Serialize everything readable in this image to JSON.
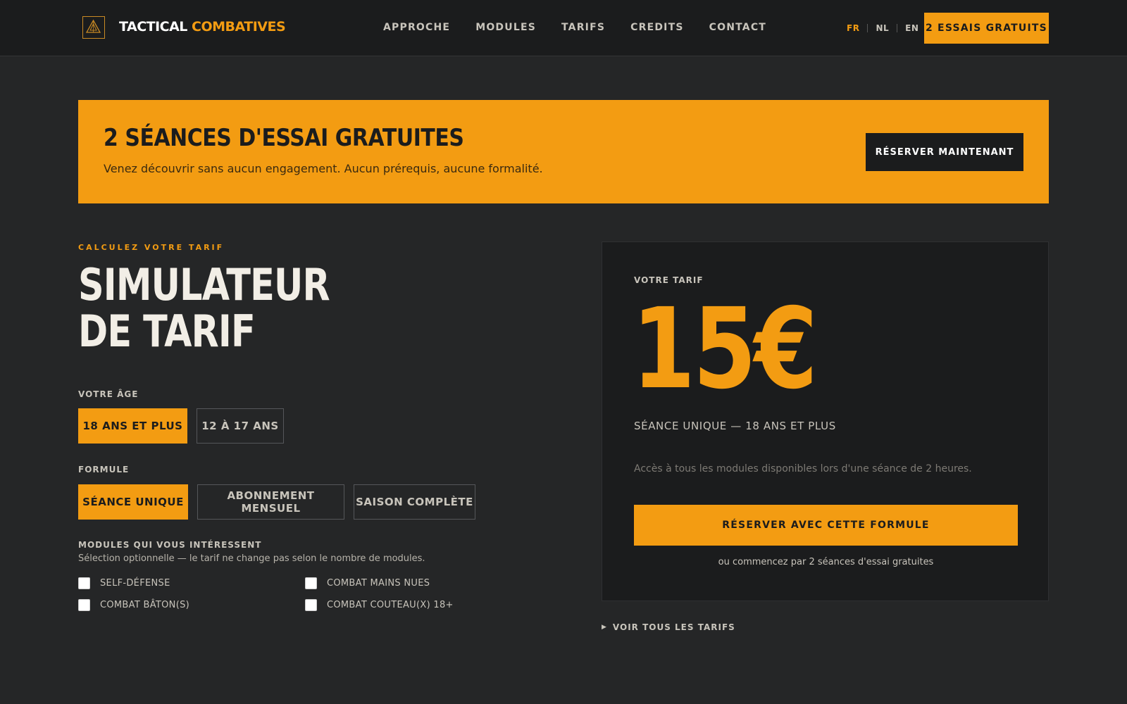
{
  "nav": {
    "brand_primary": "TACTICAL",
    "brand_accent": "COMBATIVES",
    "menu": [
      "APPROCHE",
      "MODULES",
      "TARIFS",
      "CREDITS",
      "CONTACT"
    ],
    "languages": [
      "FR",
      "NL",
      "EN"
    ],
    "active_language": "FR",
    "cta": "2 ESSAIS GRATUITS"
  },
  "banner": {
    "title": "2 SÉANCES D'ESSAI GRATUITES",
    "subtitle": "Venez découvrir sans aucun engagement. Aucun prérequis, aucune formalité.",
    "button": "RÉSERVER MAINTENANT"
  },
  "simulator": {
    "eyebrow": "CALCULEZ VOTRE TARIF",
    "title_line1": "SIMULATEUR",
    "title_line2": "DE TARIF",
    "age_label": "VOTRE ÂGE",
    "age_options": [
      "18 ANS ET PLUS",
      "12 À 17 ANS"
    ],
    "age_selected": "18 ANS ET PLUS",
    "formula_label": "FORMULE",
    "formula_options": [
      "SÉANCE UNIQUE",
      "ABONNEMENT MENSUEL",
      "SAISON COMPLÈTE"
    ],
    "formula_selected": "SÉANCE UNIQUE",
    "modules_label": "MODULES QUI VOUS INTÉRESSENT",
    "modules_hint": "Sélection optionnelle — le tarif ne change pas selon le nombre de modules.",
    "modules": [
      "SELF-DÉFENSE",
      "COMBAT MAINS NUES",
      "COMBAT BÂTON(S)",
      "COMBAT COUTEAU(X) 18+"
    ]
  },
  "result": {
    "label": "VOTRE TARIF",
    "price": "15€",
    "description": "SÉANCE UNIQUE — 18 ANS ET PLUS",
    "info": "Accès à tous les modules disponibles lors d'une séance de 2 heures.",
    "button": "RÉSERVER AVEC CETTE FORMULE",
    "alt": "ou commencez par 2 séances d'essai gratuites"
  },
  "all_tarifs": "VOIR TOUS LES TARIFS",
  "colors": {
    "accent": "#f39c12",
    "background": "#252627",
    "surface": "#1b1c1d"
  }
}
